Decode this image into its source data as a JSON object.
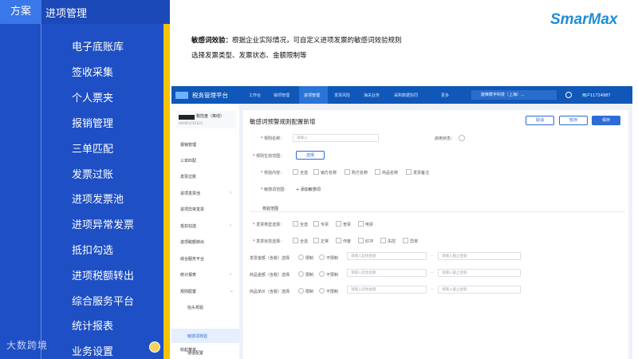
{
  "header": {
    "tab_label": "方案",
    "title": "进项管理"
  },
  "nav": {
    "items": [
      "电子底账库",
      "签收采集",
      "个人票夹",
      "报销管理",
      "三单匹配",
      "发票过账",
      "进项发票池",
      "进项异常发票",
      "抵扣勾选",
      "进项税额转出",
      "综合服务平台",
      "统计报表",
      "业务设置"
    ]
  },
  "watermark": "大数跨境",
  "logo": "SmarMax",
  "description": {
    "bold": "敏感词效验：",
    "line1": "根据企业实际情况，可自定义进项发票的敏感词效验规则",
    "line2": "选择发票类型、发票状态、金额限制等"
  },
  "app": {
    "platform_title": "税务管理平台",
    "top_nav": [
      "工作台",
      "销项管理",
      "进项管理",
      "发票风险",
      "海关业务",
      "采购数据协同",
      "更多"
    ],
    "org": "旋锋数字科技（上海）...",
    "user": "用户11724987",
    "company": {
      "name": "税控盘（离线）",
      "id": "499954761621"
    },
    "sidebar": [
      "报销管理",
      "三单匹配",
      "发票过账",
      "进项发票池",
      "进项异常发票",
      "抵扣勾选",
      "进项税额转出",
      "综合服务平台",
      "统计报表",
      "规则配置",
      "抬头校验",
      "敏感词校验",
      "通道配置",
      "收起菜单"
    ],
    "page_title": "敏感词预警规则配置新增",
    "buttons": {
      "cancel": "取消",
      "save_draft": "暂存",
      "save": "保存"
    },
    "form": {
      "rule_name_label": "* 规则名称：",
      "rule_name_placeholder": "请输入",
      "enable_label": "启用状态：",
      "scope_label": "* 规则生效范围：",
      "scope_button": "选择",
      "check_content_label": "* 校验内容：",
      "check_options": [
        "全选",
        "销方名称",
        "购方名称",
        "商品名称",
        "发票备注"
      ],
      "keyword_label": "* 敏感词范围：",
      "keyword_add": "+ 添加敏感词",
      "section_title": "校验范围",
      "type_label": "* 发票类型选择：",
      "type_options": [
        "全选",
        "专票",
        "普票",
        "电票"
      ],
      "status_label": "* 发票状态选择：",
      "status_options": [
        "全选",
        "正常",
        "作废",
        "红冲",
        "失控",
        "异常"
      ],
      "amount_rows": [
        {
          "label": "发票金额（含税）选择",
          "opt1": "限制",
          "opt2": "不限制",
          "from": "请输入起始金额",
          "to": "请输入截止金额"
        },
        {
          "label": "商品金额（含税）选择",
          "opt1": "限制",
          "opt2": "不限制",
          "from": "请输入起始金额",
          "to": "请输入截止金额"
        },
        {
          "label": "商品单价（含税）选择",
          "opt1": "限制",
          "opt2": "不限制",
          "from": "请输入起始金额",
          "to": "请输入截止金额"
        }
      ]
    }
  },
  "colors": {
    "left_panel": "#1e4fc4",
    "accent_yellow": "#f5c400",
    "app_header": "#0f57b8",
    "logo": "#1e8ed8"
  }
}
